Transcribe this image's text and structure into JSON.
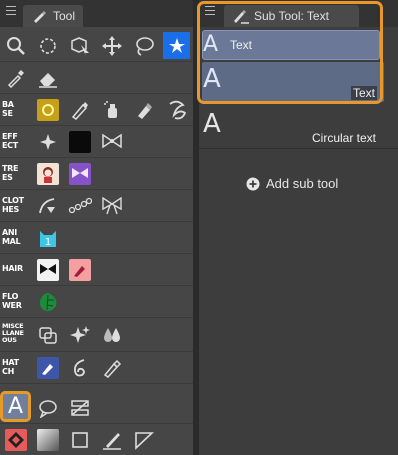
{
  "left_panel": {
    "tab_label": "Tool",
    "rows": [
      {
        "label": "",
        "tools": [
          "magnifier-icon",
          "move-icon",
          "object-select-icon",
          "move-layer-icon",
          "lasso-icon",
          "fill-selection-icon"
        ]
      },
      {
        "label": "",
        "tools": [
          "eyedropper-icon",
          "eraser-icon"
        ]
      },
      {
        "label": "BA SE",
        "tools": [
          "gold-brush-icon",
          "pen-icon",
          "spray-icon",
          "marker-icon",
          "decoration-icon"
        ]
      },
      {
        "label": "EFF ECT",
        "tools": [
          "sparkle-icon",
          "black-texture-icon",
          "bow-icon"
        ]
      },
      {
        "label": "TRE ES",
        "tools": [
          "character-icon",
          "purple-bow-icon"
        ]
      },
      {
        "label": "CLOT HES",
        "tools": [
          "lace-brush-icon",
          "chain-icon",
          "ribbon-icon"
        ]
      },
      {
        "label": "ANI MAL",
        "tools": [
          "cat-icon"
        ]
      },
      {
        "label": "HAIR",
        "tools": [
          "hair-bow-icon",
          "pink-pen-icon"
        ]
      },
      {
        "label": "FLO WER",
        "tools": [
          "monstera-leaf-icon"
        ]
      },
      {
        "label": "MISCE LLANE OUS",
        "tools": [
          "blend-icon",
          "star-sparkle-icon",
          "droplet-icon"
        ]
      },
      {
        "label": "HAT CH",
        "tools": [
          "hatch-pen-icon",
          "curl-icon",
          "nib-icon"
        ]
      },
      {
        "label": "",
        "tools": [
          "text-tool-icon",
          "balloon-icon",
          "ruler-icon"
        ]
      },
      {
        "label": "",
        "tools": [
          "fill-icon",
          "gradient-icon",
          "rectangle-icon",
          "brush-line-icon",
          "perspective-icon"
        ]
      }
    ]
  },
  "right_panel": {
    "tab_label": "Sub Tool: Text",
    "items": [
      {
        "glyph": "A",
        "name": "Text",
        "selected": true
      },
      {
        "glyph": "A",
        "name": "Text",
        "selected": true
      },
      {
        "glyph": "A",
        "name": "Circular text",
        "selected": false
      }
    ],
    "add_label": "Add sub tool"
  },
  "colors": {
    "panel_bg": "#464646",
    "selected_item": "#6b7897",
    "highlight_orange": "#e8982a",
    "fill_blue": "#1a6fe8"
  }
}
